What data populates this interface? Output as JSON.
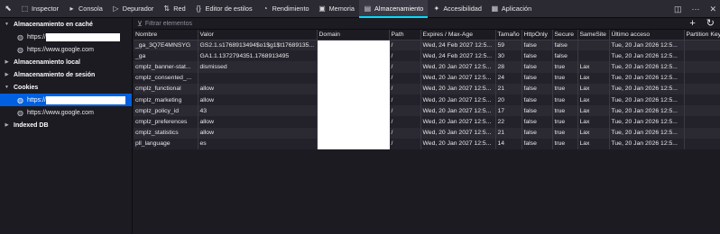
{
  "toolbar": {
    "tabs": [
      {
        "label": "Inspector",
        "icon": "inspector-icon",
        "glyph": "⬚"
      },
      {
        "label": "Consola",
        "icon": "console-icon",
        "glyph": "▸"
      },
      {
        "label": "Depurador",
        "icon": "debugger-icon",
        "glyph": "▷"
      },
      {
        "label": "Red",
        "icon": "network-icon",
        "glyph": "⇅"
      },
      {
        "label": "Editor de estilos",
        "icon": "style-editor-icon",
        "glyph": "{}"
      },
      {
        "label": "Rendimiento",
        "icon": "performance-icon",
        "glyph": "◔"
      },
      {
        "label": "Memoria",
        "icon": "memory-icon",
        "glyph": "▣"
      },
      {
        "label": "Almacenamiento",
        "icon": "storage-icon",
        "glyph": "▤"
      },
      {
        "label": "Accesibilidad",
        "icon": "accessibility-icon",
        "glyph": "✦"
      },
      {
        "label": "Aplicación",
        "icon": "application-icon",
        "glyph": "▦"
      }
    ],
    "active_tab": "Almacenamiento"
  },
  "sidebar": {
    "cache": {
      "label": "Almacenamiento en caché",
      "items": [
        "https://",
        "https://www.google.com"
      ]
    },
    "local": {
      "label": "Almacenamiento local"
    },
    "session": {
      "label": "Almacenamiento de sesión"
    },
    "cookies": {
      "label": "Cookies",
      "items": [
        "https://",
        "https://www.google.com"
      ]
    },
    "indexeddb": {
      "label": "Indexed DB"
    }
  },
  "filter": {
    "placeholder": "Filtrar elementos",
    "add": "+",
    "refresh": "↻"
  },
  "table": {
    "columns": [
      "Nombre",
      "Valor",
      "Domain",
      "Path",
      "Expires / Max-Age",
      "Tamaño",
      "HttpOnly",
      "Secure",
      "SameSite",
      "Último acceso",
      "Partition Key"
    ],
    "rows": [
      [
        "_ga_3Q7E4MNSYG",
        "GS2.1.s1768913494$o1$g1$t17689135...",
        "",
        "/",
        "Wed, 24 Feb 2027 12:5...",
        "59",
        "false",
        "false",
        "",
        "Tue, 20 Jan 2026 12:5...",
        ""
      ],
      [
        "_ga",
        "GA1.1.1372794351.1768913495",
        "",
        "/",
        "Wed, 24 Feb 2027 12:5...",
        "30",
        "false",
        "false",
        "",
        "Tue, 20 Jan 2026 12:5...",
        ""
      ],
      [
        "cmplz_banner-stat...",
        "dismissed",
        "",
        "/",
        "Wed, 20 Jan 2027 12:5...",
        "28",
        "false",
        "true",
        "Lax",
        "Tue, 20 Jan 2026 12:5...",
        ""
      ],
      [
        "cmplz_consented_...",
        "",
        "",
        "/",
        "Wed, 20 Jan 2027 12:5...",
        "24",
        "false",
        "true",
        "Lax",
        "Tue, 20 Jan 2026 12:5...",
        ""
      ],
      [
        "cmplz_functional",
        "allow",
        "",
        "/",
        "Wed, 20 Jan 2027 12:5...",
        "21",
        "false",
        "true",
        "Lax",
        "Tue, 20 Jan 2026 12:5...",
        ""
      ],
      [
        "cmplz_marketing",
        "allow",
        "",
        "/",
        "Wed, 20 Jan 2027 12:5...",
        "20",
        "false",
        "true",
        "Lax",
        "Tue, 20 Jan 2026 12:5...",
        ""
      ],
      [
        "cmplz_policy_id",
        "43",
        "",
        "/",
        "Wed, 20 Jan 2027 12:5...",
        "17",
        "false",
        "true",
        "Lax",
        "Tue, 20 Jan 2026 12:5...",
        ""
      ],
      [
        "cmplz_preferences",
        "allow",
        "",
        "/",
        "Wed, 20 Jan 2027 12:5...",
        "22",
        "false",
        "true",
        "Lax",
        "Tue, 20 Jan 2026 12:5...",
        ""
      ],
      [
        "cmplz_statistics",
        "allow",
        "",
        "/",
        "Wed, 20 Jan 2027 12:5...",
        "21",
        "false",
        "true",
        "Lax",
        "Tue, 20 Jan 2026 12:5...",
        ""
      ],
      [
        "pll_language",
        "es",
        "",
        "/",
        "Wed, 20 Jan 2027 12:5...",
        "14",
        "false",
        "true",
        "Lax",
        "Tue, 20 Jan 2026 12:5...",
        ""
      ]
    ]
  },
  "colors": {
    "accent": "#00ddff",
    "selection": "#0060df",
    "background": "#1c1b22",
    "toolbar": "#2b2a33"
  }
}
